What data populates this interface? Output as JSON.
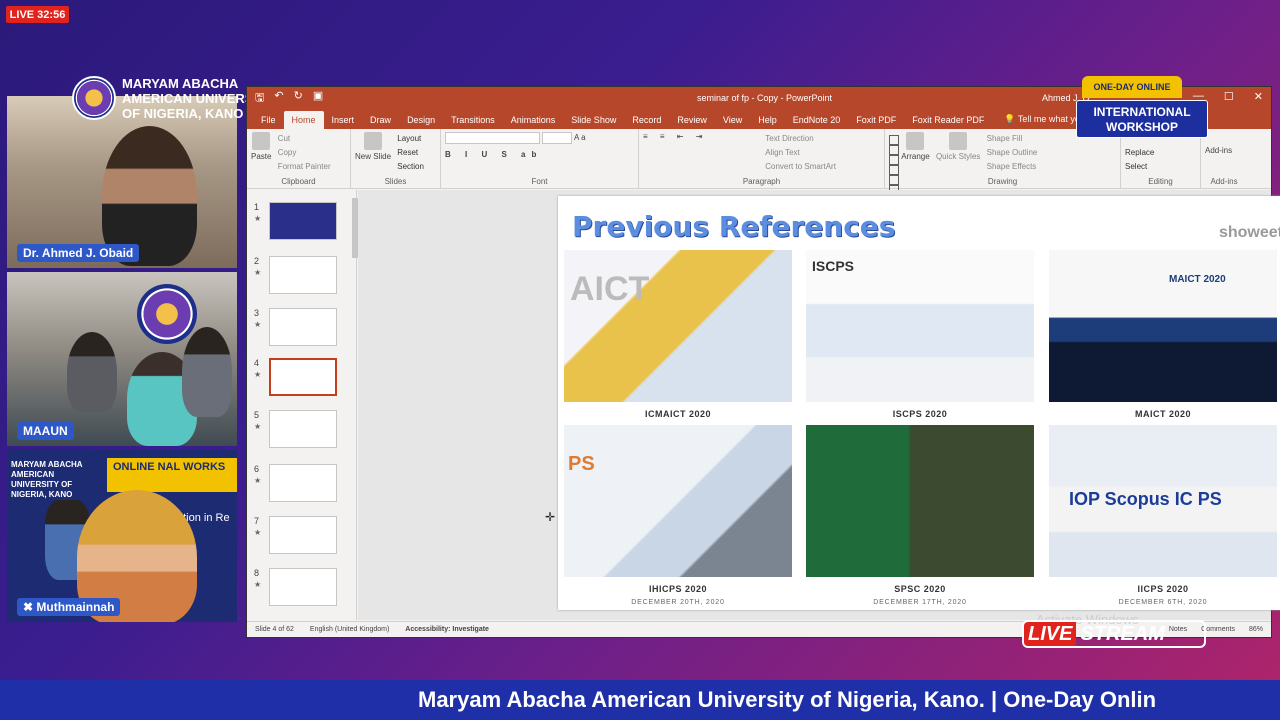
{
  "live_badge": "LIVE 32:56",
  "brand": {
    "line1": "MARYAM ABACHA",
    "line2": "AMERICAN UNIVERSITY",
    "line3": "OF NIGERIA, KANO"
  },
  "cameras": {
    "cam1_name": "Dr. Ahmed J. Obaid",
    "cam2_name": "MAAUN",
    "cam3_name": "Muthmainnah",
    "cam3_brand": "MARYAM ABACHA AMERICAN UNIVERSITY OF NIGERIA, KANO",
    "cam3_banner": "ONLINE\nNAL WORKS",
    "cam3_sub": "ation in Re"
  },
  "ppt": {
    "doc_title": "seminar of fp - Copy  -  PowerPoint",
    "user": "Ahmed J. O",
    "tabs": [
      "File",
      "Home",
      "Insert",
      "Draw",
      "Design",
      "Transitions",
      "Animations",
      "Slide Show",
      "Record",
      "Review",
      "View",
      "Help",
      "EndNote 20",
      "Foxit PDF",
      "Foxit Reader PDF"
    ],
    "tell_me": "Tell me what you want to do",
    "ribbon": {
      "paste": "Paste",
      "cut": "Cut",
      "copy": "Copy",
      "format_painter": "Format Painter",
      "clipboard": "Clipboard",
      "new_slide": "New Slide",
      "layout": "Layout",
      "reset": "Reset",
      "section": "Section",
      "slides": "Slides",
      "font": "Font",
      "paragraph": "Paragraph",
      "text_direction": "Text Direction",
      "align_text": "Align Text",
      "convert_smartart": "Convert to SmartArt",
      "arrange": "Arrange",
      "quick_styles": "Quick Styles",
      "shape_fill": "Shape Fill",
      "shape_outline": "Shape Outline",
      "shape_effects": "Shape Effects",
      "drawing": "Drawing",
      "replace": "Replace",
      "select": "Select",
      "editing": "Editing",
      "addins": "Add-ins",
      "addins_group": "Add-ins"
    },
    "slide_numbers": [
      "1",
      "2",
      "3",
      "4",
      "5",
      "6",
      "7",
      "8"
    ],
    "slide": {
      "title": "Previous References",
      "watermark": "showeet",
      "conferences": [
        {
          "name": "ICMAICT 2020",
          "date": "",
          "img_text": "AICT"
        },
        {
          "name": "ISCPS 2020",
          "date": "",
          "img_text": "ISCPS"
        },
        {
          "name": "MAICT 2020",
          "date": "",
          "img_text": "MAICT 2020"
        },
        {
          "name": "IHICPS 2020",
          "date": "DECEMBER 20TH, 2020",
          "img_text": "PS"
        },
        {
          "name": "SPSC 2020",
          "date": "DECEMBER 17TH, 2020",
          "img_text": ""
        },
        {
          "name": "IICPS 2020",
          "date": "DECEMBER 6TH, 2020",
          "img_text": "IOP Scopus IC PS"
        }
      ]
    },
    "status": {
      "slide_of": "Slide 4 of 62",
      "language": "English (United Kingdom)",
      "accessibility": "Accessibility: Investigate",
      "notes": "Notes",
      "comments": "Comments",
      "zoom": "86%"
    }
  },
  "overlays": {
    "one_day": "ONE-DAY ONLINE",
    "intl_line1": "INTERNATIONAL",
    "intl_line2": "WORKSHOP",
    "live_word": "LIVE",
    "stream_word": "STREAM",
    "activate": "Activate Windows"
  },
  "ticker": "Maryam Abacha American University of Nigeria, Kano. | One-Day Onlin"
}
